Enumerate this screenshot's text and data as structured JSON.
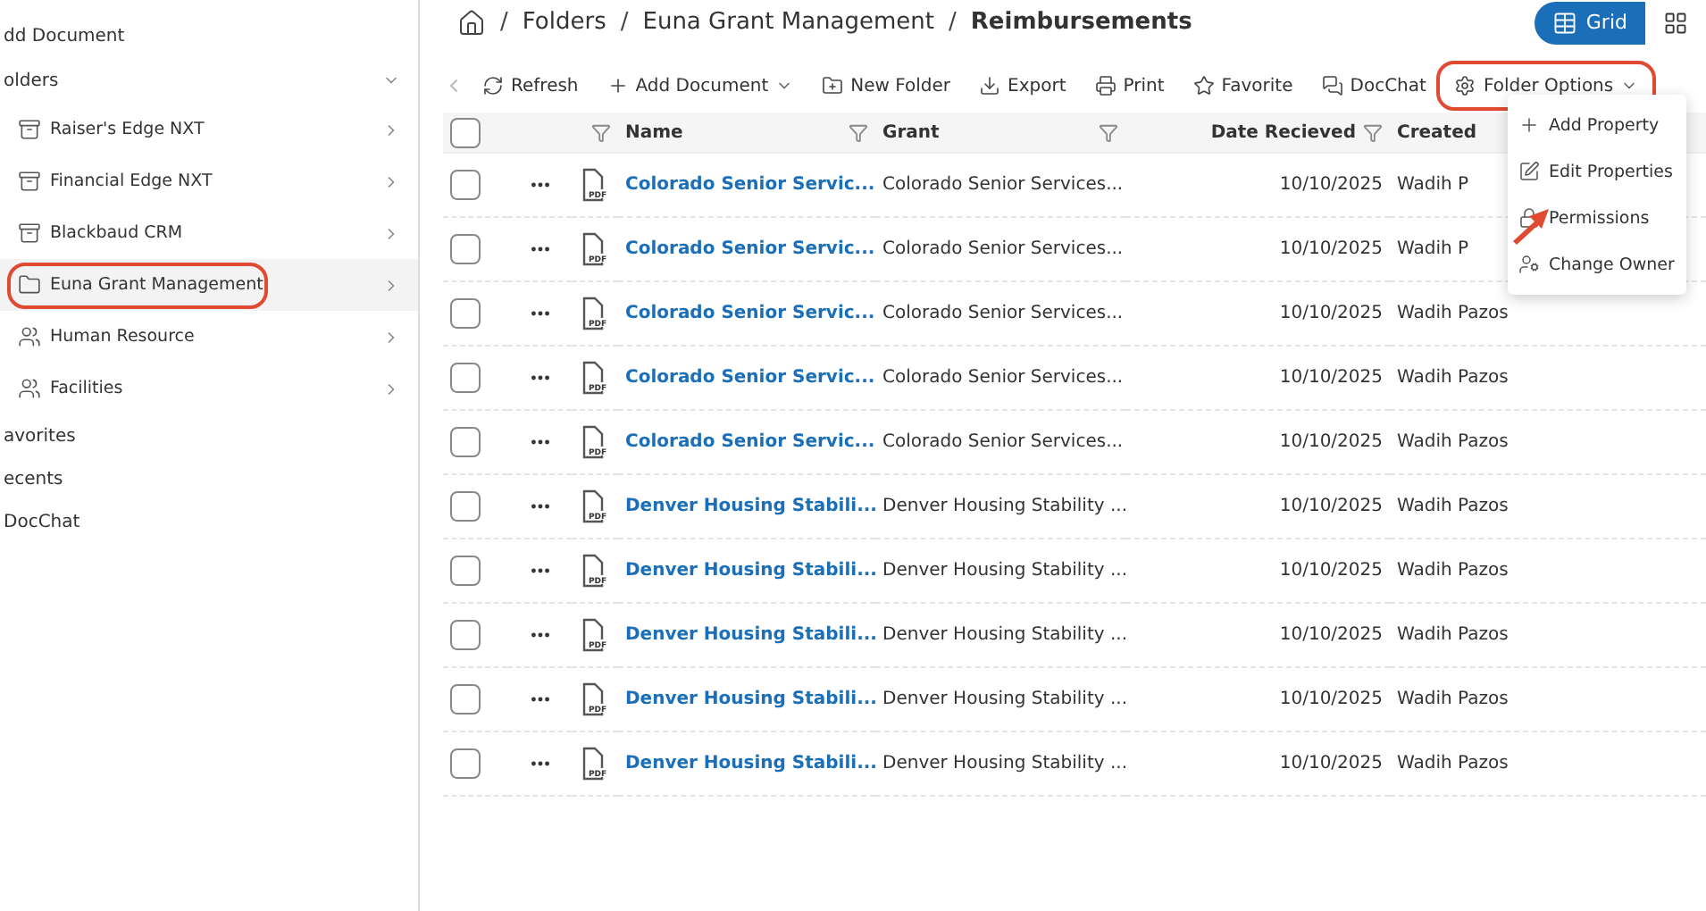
{
  "sidebar": {
    "items": [
      {
        "label": "dd Document",
        "kind": "link"
      },
      {
        "label": "olders",
        "kind": "group",
        "expanded": true,
        "children": [
          {
            "label": "Raiser's Edge NXT",
            "kind": "cabinet",
            "selected": false,
            "highlighted": false
          },
          {
            "label": "Financial Edge NXT",
            "kind": "cabinet",
            "selected": false,
            "highlighted": false
          },
          {
            "label": "Blackbaud CRM",
            "kind": "cabinet",
            "selected": false,
            "highlighted": false
          },
          {
            "label": "Euna Grant Management",
            "kind": "folder",
            "selected": true,
            "highlighted": true
          },
          {
            "label": "Human Resource",
            "kind": "people",
            "selected": false,
            "highlighted": false
          },
          {
            "label": "Facilities",
            "kind": "people",
            "selected": false,
            "highlighted": false
          }
        ]
      },
      {
        "label": "avorites",
        "kind": "link"
      },
      {
        "label": "ecents",
        "kind": "link"
      },
      {
        "label": "DocChat",
        "kind": "link"
      }
    ]
  },
  "breadcrumb": {
    "separator": "/",
    "items": [
      "Folders",
      "Euna Grant Management",
      "Reimbursements"
    ]
  },
  "view_toggle": [
    {
      "kind": "grid",
      "label": "Grid",
      "selected": true
    },
    {
      "kind": "tiles",
      "selected": false
    }
  ],
  "toolbar": [
    {
      "kind": "refresh",
      "label": "Refresh",
      "dropdown": false,
      "highlighted": false
    },
    {
      "kind": "plus",
      "label": "Add Document",
      "dropdown": true,
      "highlighted": false
    },
    {
      "kind": "folder-plus",
      "label": "New Folder",
      "dropdown": false,
      "highlighted": false
    },
    {
      "kind": "export",
      "label": "Export",
      "dropdown": false,
      "highlighted": false
    },
    {
      "kind": "print",
      "label": "Print",
      "dropdown": false,
      "highlighted": false
    },
    {
      "kind": "star",
      "label": "Favorite",
      "dropdown": false,
      "highlighted": false
    },
    {
      "kind": "chat",
      "label": "DocChat",
      "dropdown": false,
      "highlighted": false
    },
    {
      "kind": "gear",
      "label": "Folder Options",
      "dropdown": true,
      "highlighted": true
    }
  ],
  "table": {
    "columns": [
      "Name",
      "Grant",
      "Date Recieved",
      "Created"
    ],
    "select_all_checked": false,
    "rows": [
      {
        "checked": false,
        "file_type": "PDF",
        "name": "Colorado Senior Servic...",
        "grant": "Colorado Senior Services...",
        "date": "10/10/2025",
        "created": "Wadih P"
      },
      {
        "checked": false,
        "file_type": "PDF",
        "name": "Colorado Senior Servic...",
        "grant": "Colorado Senior Services...",
        "date": "10/10/2025",
        "created": "Wadih P"
      },
      {
        "checked": false,
        "file_type": "PDF",
        "name": "Colorado Senior Servic...",
        "grant": "Colorado Senior Services...",
        "date": "10/10/2025",
        "created": "Wadih Pazos"
      },
      {
        "checked": false,
        "file_type": "PDF",
        "name": "Colorado Senior Servic...",
        "grant": "Colorado Senior Services...",
        "date": "10/10/2025",
        "created": "Wadih Pazos"
      },
      {
        "checked": false,
        "file_type": "PDF",
        "name": "Colorado Senior Servic...",
        "grant": "Colorado Senior Services...",
        "date": "10/10/2025",
        "created": "Wadih Pazos"
      },
      {
        "checked": false,
        "file_type": "PDF",
        "name": "Denver Housing Stabili...",
        "grant": "Denver Housing Stability ...",
        "date": "10/10/2025",
        "created": "Wadih Pazos"
      },
      {
        "checked": false,
        "file_type": "PDF",
        "name": "Denver Housing Stabili...",
        "grant": "Denver Housing Stability ...",
        "date": "10/10/2025",
        "created": "Wadih Pazos"
      },
      {
        "checked": false,
        "file_type": "PDF",
        "name": "Denver Housing Stabili...",
        "grant": "Denver Housing Stability ...",
        "date": "10/10/2025",
        "created": "Wadih Pazos"
      },
      {
        "checked": false,
        "file_type": "PDF",
        "name": "Denver Housing Stabili...",
        "grant": "Denver Housing Stability ...",
        "date": "10/10/2025",
        "created": "Wadih Pazos"
      },
      {
        "checked": false,
        "file_type": "PDF",
        "name": "Denver Housing Stabili...",
        "grant": "Denver Housing Stability ...",
        "date": "10/10/2025",
        "created": "Wadih Pazos"
      }
    ]
  },
  "folder_menu": {
    "items": [
      {
        "kind": "plus",
        "label": "Add Property",
        "pointed": false
      },
      {
        "kind": "edit",
        "label": "Edit Properties",
        "pointed": false
      },
      {
        "kind": "lock",
        "label": "Permissions",
        "pointed": true
      },
      {
        "kind": "user-gear",
        "label": "Change Owner",
        "pointed": false
      }
    ]
  }
}
